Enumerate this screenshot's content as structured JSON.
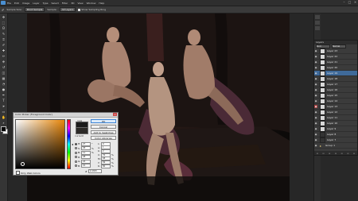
{
  "menubar": {
    "items": [
      "File",
      "Edit",
      "Image",
      "Layer",
      "Type",
      "Select",
      "Filter",
      "3D",
      "View",
      "Window",
      "Help"
    ],
    "window_controls": {
      "minimize": "–",
      "maximize": "□",
      "close": "×"
    }
  },
  "options": {
    "sample_size_label": "Sample Size:",
    "sample_size_value": "Point Sample",
    "sample_label": "Sample:",
    "sample_value": "All Layers",
    "show_ring_label": "Show Sampling Ring"
  },
  "tools": [
    "move",
    "marquee",
    "lasso",
    "quick-select",
    "crop",
    "eyedropper",
    "heal",
    "brush",
    "stamp",
    "history-brush",
    "eraser",
    "gradient",
    "blur",
    "dodge",
    "pen",
    "type",
    "path-select",
    "shape",
    "hand",
    "zoom"
  ],
  "tool_glyphs": [
    "✥",
    "⬚",
    "ʘ",
    "✎",
    "⌗",
    "✐",
    "✚",
    "✏",
    "⎈",
    "↺",
    "◫",
    "▦",
    "◔",
    "●",
    "✒",
    "T",
    "➤",
    "▭",
    "✋",
    "⌕"
  ],
  "document": {
    "background": "#161210",
    "accent_colors": {
      "skin_light": "#c9a58e",
      "skin_mid": "#8f6b5a",
      "drape": "#5a3342",
      "curtain": "#2a1c1a"
    }
  },
  "layers": {
    "title": "Layers",
    "kind_label": "Kind",
    "blend_mode": "Normal",
    "opacity_label": "Opacity:",
    "rows": [
      {
        "name": "Layer 23",
        "thumb": "light",
        "eye": "normal"
      },
      {
        "name": "Layer 22",
        "thumb": "light",
        "eye": "normal"
      },
      {
        "name": "Layer 21",
        "thumb": "light",
        "eye": "normal"
      },
      {
        "name": "Layer 20",
        "thumb": "light",
        "eye": "normal"
      },
      {
        "name": "Layer 19",
        "thumb": "light",
        "eye": "normal",
        "selected": true
      },
      {
        "name": "Layer 18",
        "thumb": "light",
        "eye": "normal"
      },
      {
        "name": "Layer 17",
        "thumb": "light",
        "eye": "normal"
      },
      {
        "name": "Layer 16",
        "thumb": "light",
        "eye": "normal"
      },
      {
        "name": "Layer 15",
        "thumb": "light",
        "eye": "normal"
      },
      {
        "name": "Layer 14",
        "thumb": "light",
        "eye": "normal"
      },
      {
        "name": "Layer 13",
        "thumb": "light",
        "eye": "red"
      },
      {
        "name": "Layer 12",
        "thumb": "light",
        "eye": "normal"
      },
      {
        "name": "Layer 11",
        "thumb": "light",
        "eye": "normal"
      },
      {
        "name": "Layer 10",
        "thumb": "light",
        "eye": "normal"
      },
      {
        "name": "Layer 9",
        "thumb": "light",
        "eye": "normal"
      },
      {
        "name": "Layer 8",
        "thumb": "dark",
        "eye": "normal"
      },
      {
        "name": "Layer 7",
        "thumb": "dark",
        "eye": "normal"
      },
      {
        "name": "Group 1",
        "thumb": "folder",
        "eye": "normal"
      }
    ],
    "footer_icons": [
      "link-icon",
      "fx-icon",
      "mask-icon",
      "adjustment-icon",
      "folder-icon",
      "new-layer-icon",
      "trash-icon"
    ]
  },
  "color_picker": {
    "title": "Color Picker (Foreground Color)",
    "new_label": "new",
    "current_label": "current",
    "new_color": "#1b1b1b",
    "current_color": "#2c2a28",
    "buttons": {
      "ok": "OK",
      "cancel": "Cancel",
      "add_to_swatches": "Add to Swatches",
      "color_libraries": "Color Libraries"
    },
    "fields": [
      {
        "label": "H:",
        "value": "27",
        "unit": "°",
        "checked": true
      },
      {
        "label": "S:",
        "value": "26",
        "unit": "%",
        "checked": false
      },
      {
        "label": "B:",
        "value": "11",
        "unit": "%",
        "checked": false
      },
      {
        "label": "R:",
        "value": "28",
        "unit": "",
        "checked": false
      },
      {
        "label": "G:",
        "value": "24",
        "unit": "",
        "checked": false
      },
      {
        "label": "B:",
        "value": "21",
        "unit": "",
        "checked": false
      }
    ],
    "lab_fields": [
      {
        "label": "L:",
        "value": "9",
        "unit": ""
      },
      {
        "label": "a:",
        "value": "1",
        "unit": ""
      },
      {
        "label": "b:",
        "value": "2",
        "unit": ""
      },
      {
        "label": "C:",
        "value": "70",
        "unit": "%"
      },
      {
        "label": "M:",
        "value": "68",
        "unit": "%"
      },
      {
        "label": "Y:",
        "value": "69",
        "unit": "%"
      },
      {
        "label": "K:",
        "value": "80",
        "unit": "%"
      }
    ],
    "hex_label": "#",
    "hex_value": "1c1815",
    "web_only_label": "Only Web Colors"
  }
}
